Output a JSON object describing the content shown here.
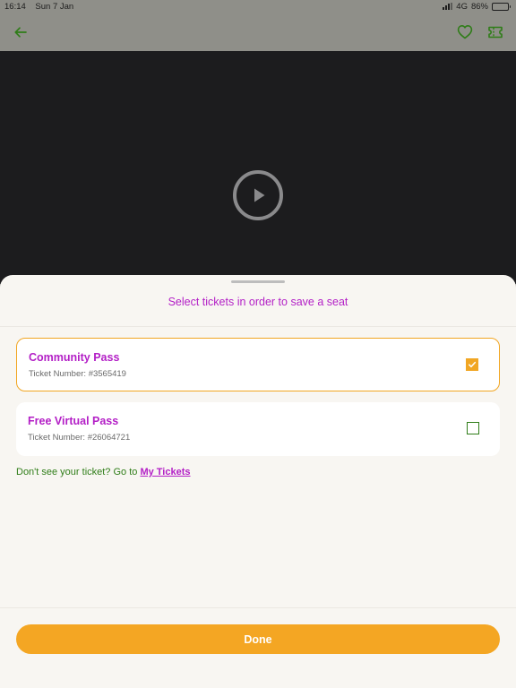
{
  "status_bar": {
    "time": "16:14",
    "date": "Sun 7 Jan",
    "network": "4G",
    "battery": "86%",
    "battery_level": 0.86
  },
  "nav": {
    "back_icon": "arrow-left-icon",
    "favorite_icon": "heart-icon",
    "ticket_icon": "ticket-icon"
  },
  "video": {
    "play_icon": "play-icon"
  },
  "sheet": {
    "title": "Select tickets in order to save a seat",
    "tickets": [
      {
        "name": "Community Pass",
        "number": "Ticket Number: #3565419",
        "selected": true
      },
      {
        "name": "Free Virtual Pass",
        "number": "Ticket Number: #26064721",
        "selected": false
      }
    ],
    "help_text": "Don't see your ticket? Go to",
    "help_link": "My Tickets",
    "done_label": "Done"
  },
  "colors": {
    "accent": "#f4a623",
    "brand_purple": "#b31fc6",
    "brand_green": "#2f7d18",
    "sheet_background": "#f8f6f2"
  }
}
